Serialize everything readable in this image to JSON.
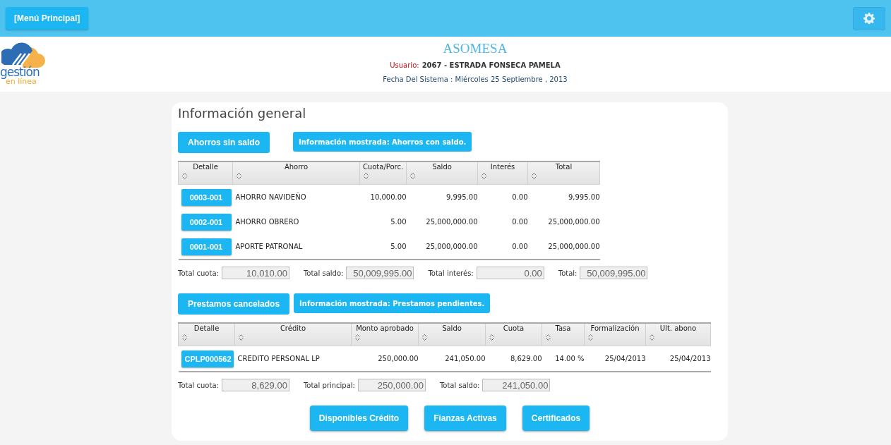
{
  "topbar": {
    "menu_button": "[Menú Principal]"
  },
  "header": {
    "logo": {
      "line1": "gestión",
      "line2": "en línea"
    },
    "title": "ASOMESA",
    "user_label": "Usuario:",
    "user_value": "2067 - ESTRADA FONSECA PAMELA",
    "date": "Fecha Del Sistema : Miércoles 25 Septiembre , 2013"
  },
  "card": {
    "title": "Información general",
    "savings": {
      "toggle_button": "Ahorros sin saldo",
      "info": "Información mostrada: Ahorros con saldo.",
      "columns": [
        "Detalle",
        "Ahorro",
        "Cuota/Porc.",
        "Saldo",
        "Interés",
        "Total"
      ],
      "rows": [
        {
          "cells": [
            "0003-001",
            "AHORRO NAVIDEÑO",
            "10,000.00",
            "9,995.00",
            "0.00",
            "9,995.00"
          ]
        },
        {
          "cells": [
            "0002-001",
            "AHORRO OBRERO",
            "5.00",
            "25,000,000.00",
            "0.00",
            "25,000,000.00"
          ]
        },
        {
          "cells": [
            "0001-001",
            "APORTE PATRONAL",
            "5.00",
            "25,000,000.00",
            "0.00",
            "25,000,000.00"
          ]
        }
      ],
      "totals": [
        {
          "label": "Total cuota:",
          "value": "10,010.00"
        },
        {
          "label": "Total saldo:",
          "value": "50,009,995.00"
        },
        {
          "label": "Total interés:",
          "value": "0.00"
        },
        {
          "label": "Total:",
          "value": "50,009,995.00"
        }
      ]
    },
    "loans": {
      "toggle_button": "Prestamos cancelados",
      "info": "Información mostrada: Prestamos pendientes.",
      "columns": [
        "Detalle",
        "Crédito",
        "Monto aprobado",
        "Saldo",
        "Cuota",
        "Tasa",
        "Formalización",
        "Ult. abono"
      ],
      "rows": [
        {
          "cells": [
            "CPLP000562",
            "CREDITO PERSONAL LP",
            "250,000.00",
            "241,050.00",
            "8,629.00",
            "14.00 %",
            "25/04/2013",
            "25/04/2013"
          ]
        }
      ],
      "totals": [
        {
          "label": "Total cuota:",
          "value": "8,629.00"
        },
        {
          "label": "Total principal:",
          "value": "250,000.00"
        },
        {
          "label": "Total saldo:",
          "value": "241,050.00"
        }
      ]
    },
    "actions": [
      "Disponibles Crédito",
      "Fianzas Activas",
      "Certificados"
    ]
  }
}
